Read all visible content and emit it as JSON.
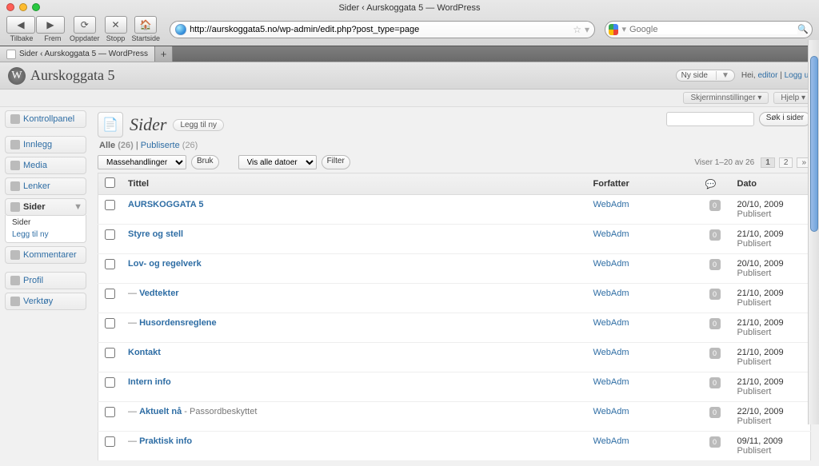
{
  "window_title": "Sider ‹ Aurskoggata 5 — WordPress",
  "browser": {
    "back_label": "Tilbake",
    "forward_label": "Frem",
    "reload_label": "Oppdater",
    "stop_label": "Stopp",
    "home_label": "Startside",
    "url": "http://aurskoggata5.no/wp-admin/edit.php?post_type=page",
    "search_placeholder": "Google",
    "tab_title": "Sider ‹ Aurskoggata 5 — WordPress"
  },
  "site_title": "Aurskoggata 5",
  "topbar": {
    "new_side": "Ny side",
    "greeting": "Hei, ",
    "user": "editor",
    "logout": "Logg ut",
    "screen_opts": "Skjerminnstillinger",
    "help": "Hjelp"
  },
  "sidebar": {
    "dashboard": "Kontrollpanel",
    "posts": "Innlegg",
    "media": "Media",
    "links": "Lenker",
    "pages": "Sider",
    "pages_sub_all": "Sider",
    "pages_sub_new": "Legg til ny",
    "comments": "Kommentarer",
    "profile": "Profil",
    "tools": "Verktøy"
  },
  "page": {
    "title": "Sider",
    "add_new": "Legg til ny",
    "filter_all_label": "Alle",
    "filter_all_count": "(26)",
    "filter_pub_label": "Publiserte",
    "filter_pub_count": "(26)",
    "bulk_actions": "Massehandlinger",
    "apply": "Bruk",
    "date_filter": "Vis alle datoer",
    "filter_btn": "Filter",
    "search_btn": "Søk i sider",
    "displaying": "Viser 1–20 av 26",
    "page1": "1",
    "page2": "2",
    "next": "»"
  },
  "columns": {
    "title": "Tittel",
    "author": "Forfatter",
    "date": "Dato"
  },
  "rows": [
    {
      "title": "AURSKOGGATA 5",
      "indent": "",
      "author": "WebAdm",
      "comments": "0",
      "date": "20/10, 2009",
      "status": "Publisert",
      "suffix": ""
    },
    {
      "title": "Styre og stell",
      "indent": "",
      "author": "WebAdm",
      "comments": "0",
      "date": "21/10, 2009",
      "status": "Publisert",
      "suffix": ""
    },
    {
      "title": "Lov- og regelverk",
      "indent": "",
      "author": "WebAdm",
      "comments": "0",
      "date": "20/10, 2009",
      "status": "Publisert",
      "suffix": ""
    },
    {
      "title": "Vedtekter",
      "indent": "— ",
      "author": "WebAdm",
      "comments": "0",
      "date": "21/10, 2009",
      "status": "Publisert",
      "suffix": ""
    },
    {
      "title": "Husordensreglene",
      "indent": "— ",
      "author": "WebAdm",
      "comments": "0",
      "date": "21/10, 2009",
      "status": "Publisert",
      "suffix": ""
    },
    {
      "title": "Kontakt",
      "indent": "",
      "author": "WebAdm",
      "comments": "0",
      "date": "21/10, 2009",
      "status": "Publisert",
      "suffix": ""
    },
    {
      "title": "Intern info",
      "indent": "",
      "author": "WebAdm",
      "comments": "0",
      "date": "21/10, 2009",
      "status": "Publisert",
      "suffix": ""
    },
    {
      "title": "Aktuelt nå",
      "indent": "— ",
      "author": "WebAdm",
      "comments": "0",
      "date": "22/10, 2009",
      "status": "Publisert",
      "suffix": " - Passordbeskyttet"
    },
    {
      "title": "Praktisk info",
      "indent": "— ",
      "author": "WebAdm",
      "comments": "0",
      "date": "09/11, 2009",
      "status": "Publisert",
      "suffix": ""
    }
  ]
}
